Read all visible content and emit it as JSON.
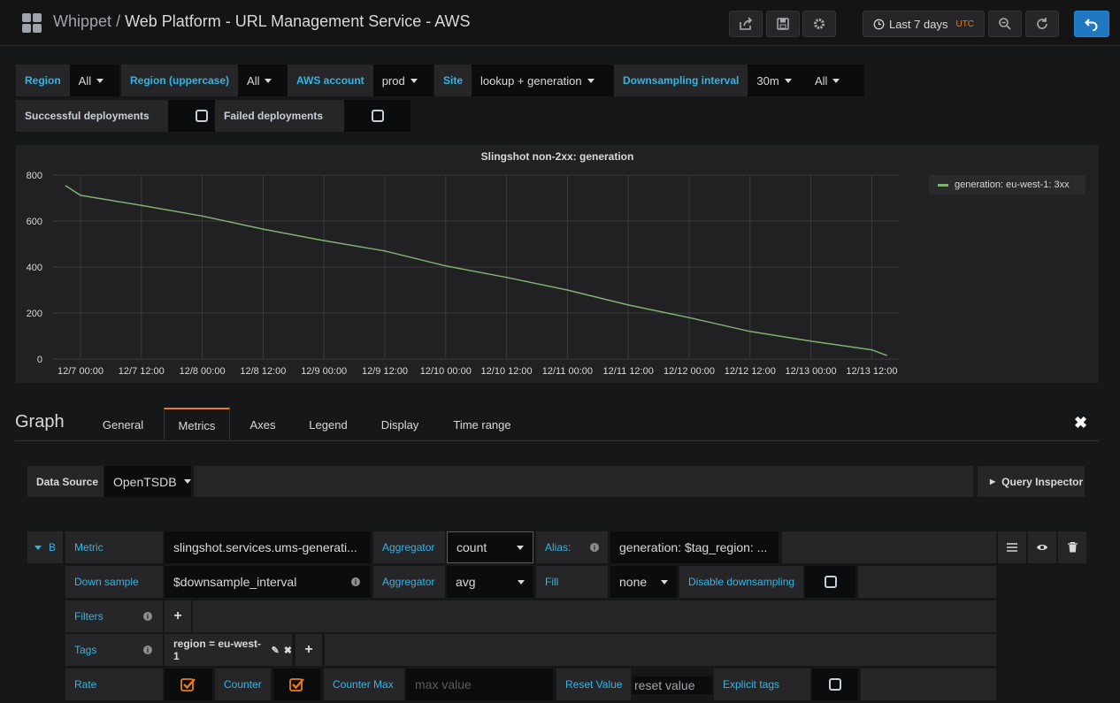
{
  "nav": {
    "app": "Whippet",
    "separator": "/",
    "dashboard": "Web Platform - URL Management Service - AWS",
    "time_range": "Last 7 days",
    "timezone": "UTC"
  },
  "variables": [
    {
      "label": "Region",
      "value": "All"
    },
    {
      "label": "Region (uppercase)",
      "value": "All"
    },
    {
      "label": "AWS account",
      "value": "prod"
    },
    {
      "label": "Site",
      "value": "lookup + generation"
    },
    {
      "label": "Downsampling interval",
      "value": "30m"
    },
    {
      "label": "",
      "value": "All"
    }
  ],
  "annotations": [
    {
      "label": "Successful deployments"
    },
    {
      "label": "Failed deployments"
    }
  ],
  "panel": {
    "title": "Slingshot non-2xx: generation",
    "legend": "generation: eu-west-1: 3xx"
  },
  "chart_data": {
    "type": "line",
    "title": "Slingshot non-2xx: generation",
    "x_tick_labels": [
      "12/7 00:00",
      "12/7 12:00",
      "12/8 00:00",
      "12/8 12:00",
      "12/9 00:00",
      "12/9 12:00",
      "12/10 00:00",
      "12/10 12:00",
      "12/11 00:00",
      "12/11 12:00",
      "12/12 00:00",
      "12/12 12:00",
      "12/13 00:00",
      "12/13 12:00"
    ],
    "y_ticks": [
      0,
      200,
      400,
      600,
      800
    ],
    "ylim": [
      0,
      800
    ],
    "grid": true,
    "legend_position": "right",
    "series": [
      {
        "name": "generation: eu-west-1: 3xx",
        "color": "#7eb26d",
        "x": [
          "12/6 21:00",
          "12/7 00:00",
          "12/7 12:00",
          "12/8 00:00",
          "12/8 12:00",
          "12/9 00:00",
          "12/9 12:00",
          "12/10 00:00",
          "12/10 12:00",
          "12/11 00:00",
          "12/11 12:00",
          "12/12 00:00",
          "12/12 12:00",
          "12/13 00:00",
          "12/13 12:00",
          "12/13 15:00"
        ],
        "y": [
          755,
          712,
          668,
          622,
          565,
          515,
          470,
          405,
          355,
          300,
          235,
          180,
          120,
          78,
          40,
          15
        ]
      }
    ]
  },
  "editor": {
    "title": "Graph",
    "tabs": [
      "General",
      "Metrics",
      "Axes",
      "Legend",
      "Display",
      "Time range"
    ],
    "active_tab": "Metrics",
    "datasource_label": "Data Source",
    "datasource_value": "OpenTSDB",
    "query_inspector": "Query Inspector",
    "query": {
      "ref": "B",
      "metric_label": "Metric",
      "metric_value": "slingshot.services.ums-generati...",
      "aggregator_label": "Aggregator",
      "aggregator_value": "count",
      "alias_label": "Alias:",
      "alias_value": "generation: $tag_region: ...",
      "downsample_label": "Down sample",
      "downsample_value": "$downsample_interval",
      "ds_aggregator_label": "Aggregator",
      "ds_aggregator_value": "avg",
      "fill_label": "Fill",
      "fill_value": "none",
      "disable_downsampling_label": "Disable downsampling",
      "filters_label": "Filters",
      "tags_label": "Tags",
      "tag_value": "region = eu-west-1",
      "rate_label": "Rate",
      "counter_label": "Counter",
      "counter_max_label": "Counter Max",
      "counter_max_placeholder": "max value",
      "reset_value_label": "Reset Value",
      "reset_value_placeholder": "reset value",
      "explicit_tags_label": "Explicit tags"
    }
  }
}
